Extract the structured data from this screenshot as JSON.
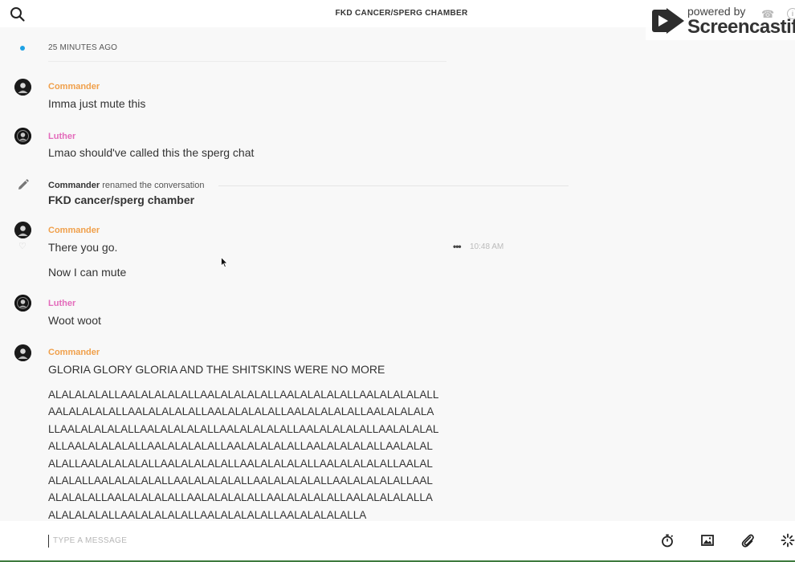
{
  "header": {
    "title": "FKD CANCER/SPERG CHAMBER",
    "watermark_powered": "powered by",
    "watermark_brand": "Screencastify"
  },
  "timeline": {
    "label": "25 MINUTES AGO"
  },
  "messages": [
    {
      "sender": "Commander",
      "text": "Imma just mute this"
    },
    {
      "sender": "Luther",
      "text": "Lmao should've called this the sperg chat"
    }
  ],
  "rename_event": {
    "actor": "Commander",
    "action": "renamed the conversation",
    "new_name": "FKD cancer/sperg chamber"
  },
  "group1": {
    "sender": "Commander",
    "line1": "There you go.",
    "line2": "Now I can mute",
    "time": "10:48 AM",
    "more_icon": "•••"
  },
  "group2": {
    "sender": "Luther",
    "text": "Woot woot"
  },
  "group3": {
    "sender": "Commander",
    "text": "GLORIA GLORY GLORIA AND THE SHITSKINS WERE NO MORE",
    "la_lines": [
      "ALALALALALLAALALALALALLAALALALALALLAALALALALALLAALALALALALL",
      "AALALALALALLAALALALALALLAALALALALALLAALALALALALLAALALALALA",
      "LLAALALALALALLAALALALALALLAALALALALALLAALALALALALLAALALALAL",
      "ALLAALALALALALLAALALALALALLAALALALALALLAALALALALALLAALALAL",
      "ALALLAALALALALALLAALALALALALLAALALALALALLAALALALALALLAALAL",
      "ALALALLAALALALALALLAALALALALALLAALALALALALLAALALALALALLAAL",
      "ALALALALLAALALALALALLAALALALALALLAALALALALALLAALALALALALLA",
      "ALALALALALLAALALALALALLAALALALALALLAALALALALALLA"
    ]
  },
  "composer": {
    "placeholder": "TYPE A MESSAGE"
  },
  "icons": {
    "search": "search-icon",
    "timer": "stopwatch-icon",
    "image": "image-icon",
    "attach": "paperclip-icon",
    "loading": "spinner-icon"
  },
  "colors": {
    "commander": "#f0a04b",
    "luther": "#e36bbb",
    "unread_dot": "#1ea1e4"
  }
}
